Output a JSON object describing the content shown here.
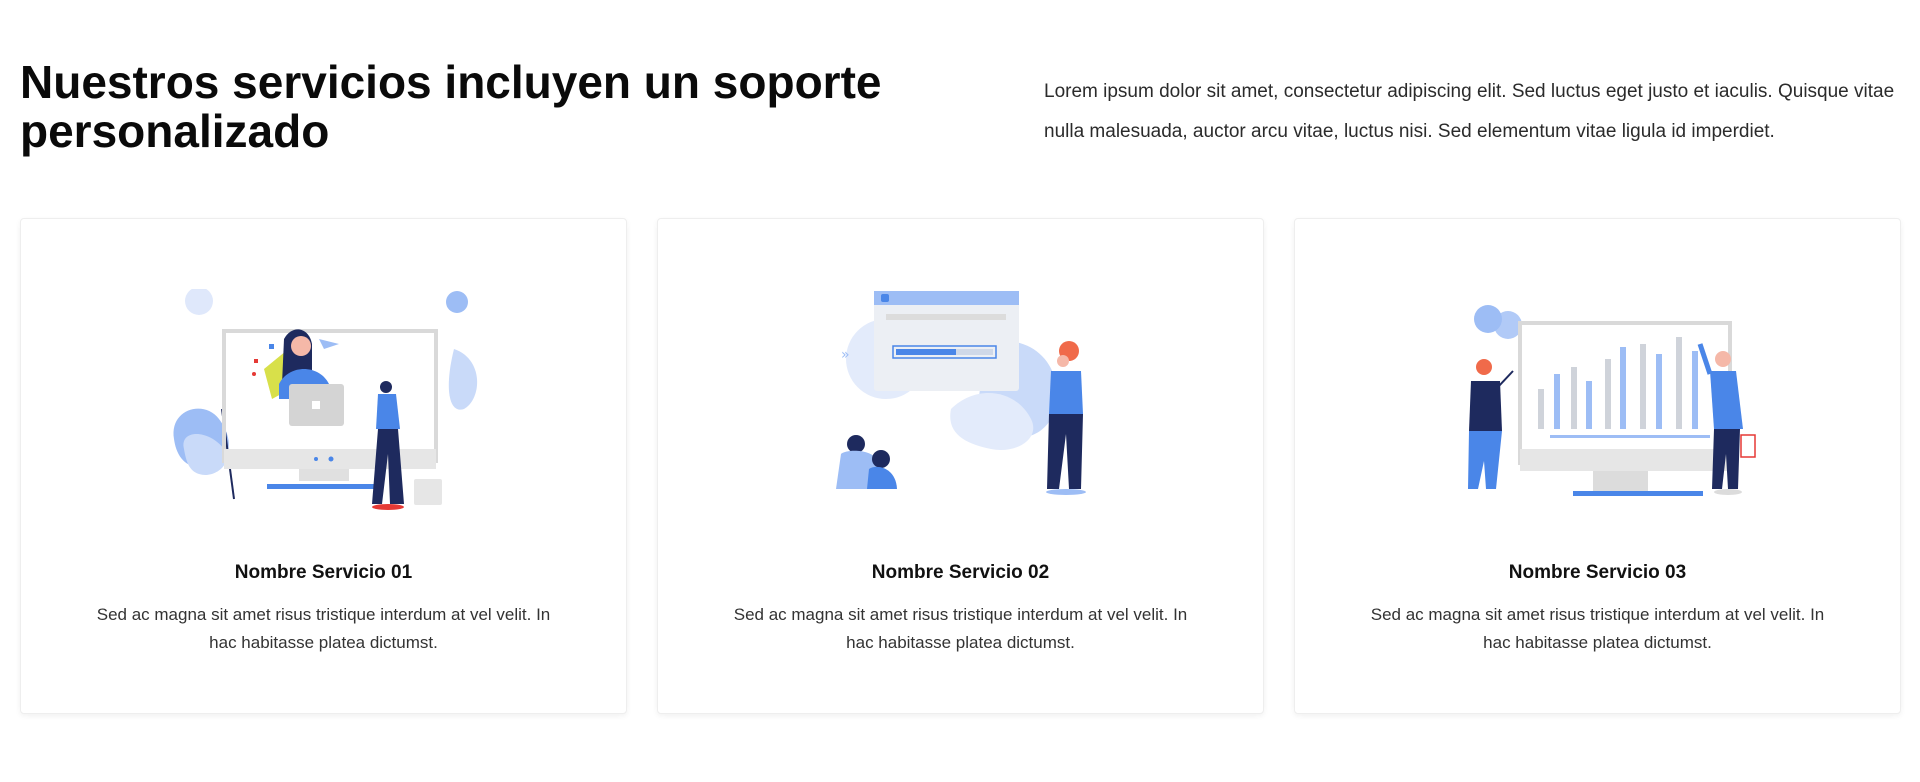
{
  "header": {
    "title": "Nuestros servicios incluyen un soporte personalizado",
    "intro": "Lorem ipsum dolor sit amet, consectetur adipiscing elit. Sed luctus eget justo et iaculis. Quisque vitae nulla malesuada, auctor arcu vitae, luctus nisi. Sed elementum vitae ligula id imperdiet."
  },
  "services": [
    {
      "title": "Nombre Servicio 01",
      "description": "Sed ac magna sit amet risus tristique interdum at vel velit. In hac habitasse platea dictumst.",
      "icon": "support-agent-illustration"
    },
    {
      "title": "Nombre Servicio 02",
      "description": "Sed ac magna sit amet risus tristique interdum at vel velit. In hac habitasse platea dictumst.",
      "icon": "loading-progress-illustration"
    },
    {
      "title": "Nombre Servicio 03",
      "description": "Sed ac magna sit amet risus tristique interdum at vel velit. In hac habitasse platea dictumst.",
      "icon": "analytics-chart-illustration"
    }
  ],
  "colors": {
    "accent": "#4a86e8",
    "accent_light": "#9dbdf5",
    "navy": "#1e2a5e",
    "grey": "#d9d9d9"
  }
}
